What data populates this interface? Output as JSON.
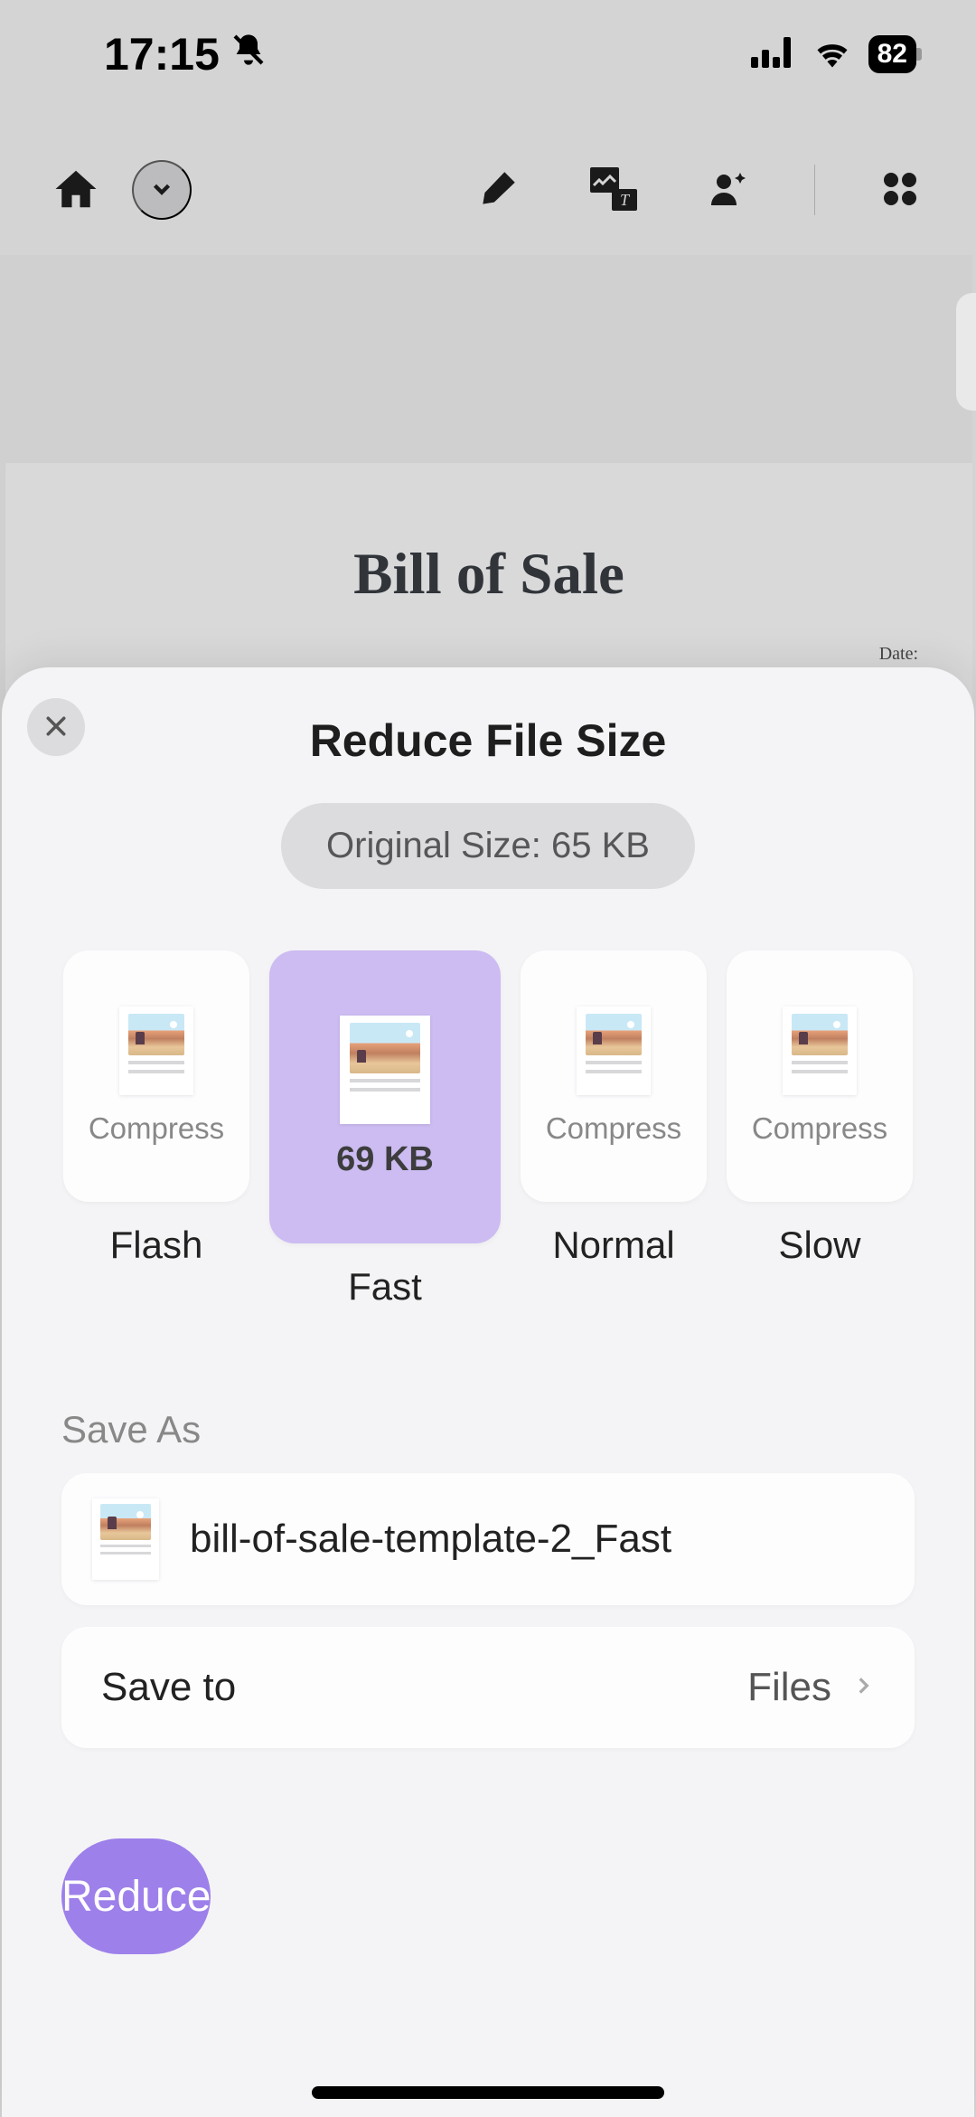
{
  "status": {
    "time": "17:15",
    "battery": "82"
  },
  "document": {
    "title": "Bill of Sale",
    "date_label": "Date:"
  },
  "sheet": {
    "title": "Reduce File Size",
    "original_size_label": "Original Size: 65 KB",
    "options": [
      {
        "status": "Compress",
        "label": "Flash"
      },
      {
        "status": "69 KB",
        "label": "Fast"
      },
      {
        "status": "Compress",
        "label": "Normal"
      },
      {
        "status": "Compress",
        "label": "Slow"
      }
    ],
    "save_as_heading": "Save As",
    "filename": "bill-of-sale-template-2_Fast",
    "save_to_label": "Save to",
    "save_to_value": "Files",
    "reduce_button": "Reduce"
  }
}
